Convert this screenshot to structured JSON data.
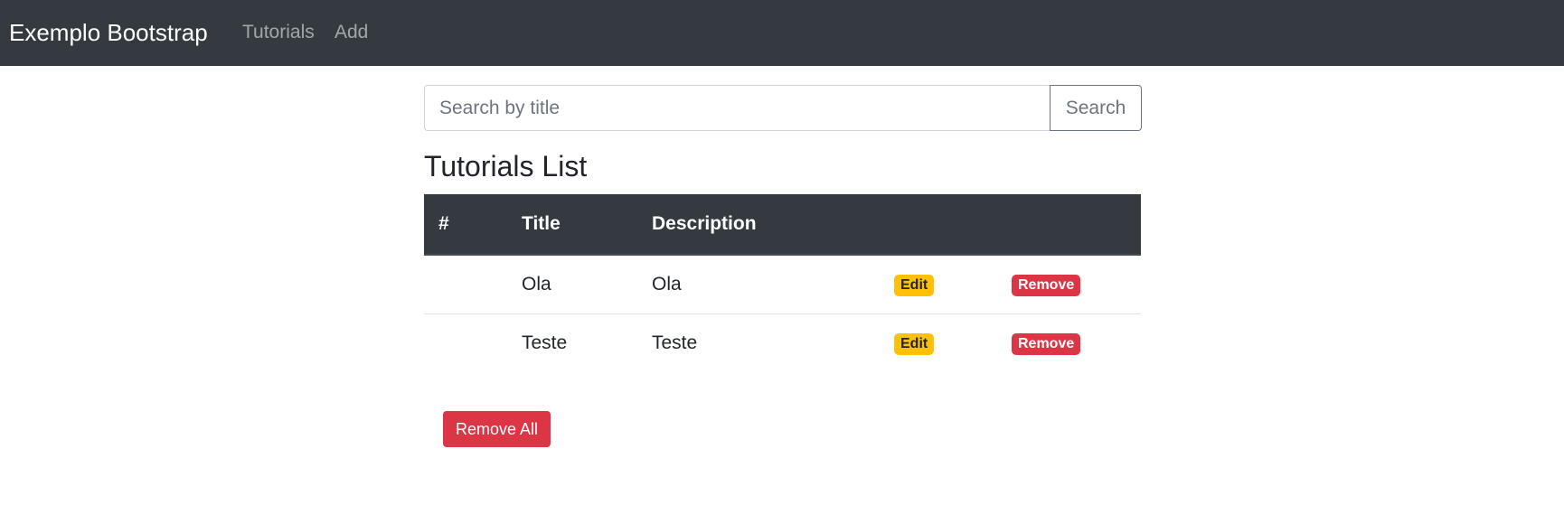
{
  "navbar": {
    "brand": "Exemplo Bootstrap",
    "links": [
      {
        "label": "Tutorials"
      },
      {
        "label": "Add"
      }
    ],
    "background_color": "#343a40"
  },
  "search": {
    "placeholder": "Search by title",
    "value": "",
    "button_label": "Search"
  },
  "main": {
    "title": "Tutorials List",
    "table": {
      "columns": [
        "#",
        "Title",
        "Description"
      ],
      "rows": [
        {
          "id": "",
          "title": "Ola",
          "description": "Ola",
          "edit_label": "Edit",
          "remove_label": "Remove"
        },
        {
          "id": "",
          "title": "Teste",
          "description": "Teste",
          "edit_label": "Edit",
          "remove_label": "Remove"
        }
      ]
    },
    "remove_all_label": "Remove All"
  },
  "colors": {
    "warning": "#ffc107",
    "danger": "#dc3545",
    "dark": "#343a40"
  }
}
